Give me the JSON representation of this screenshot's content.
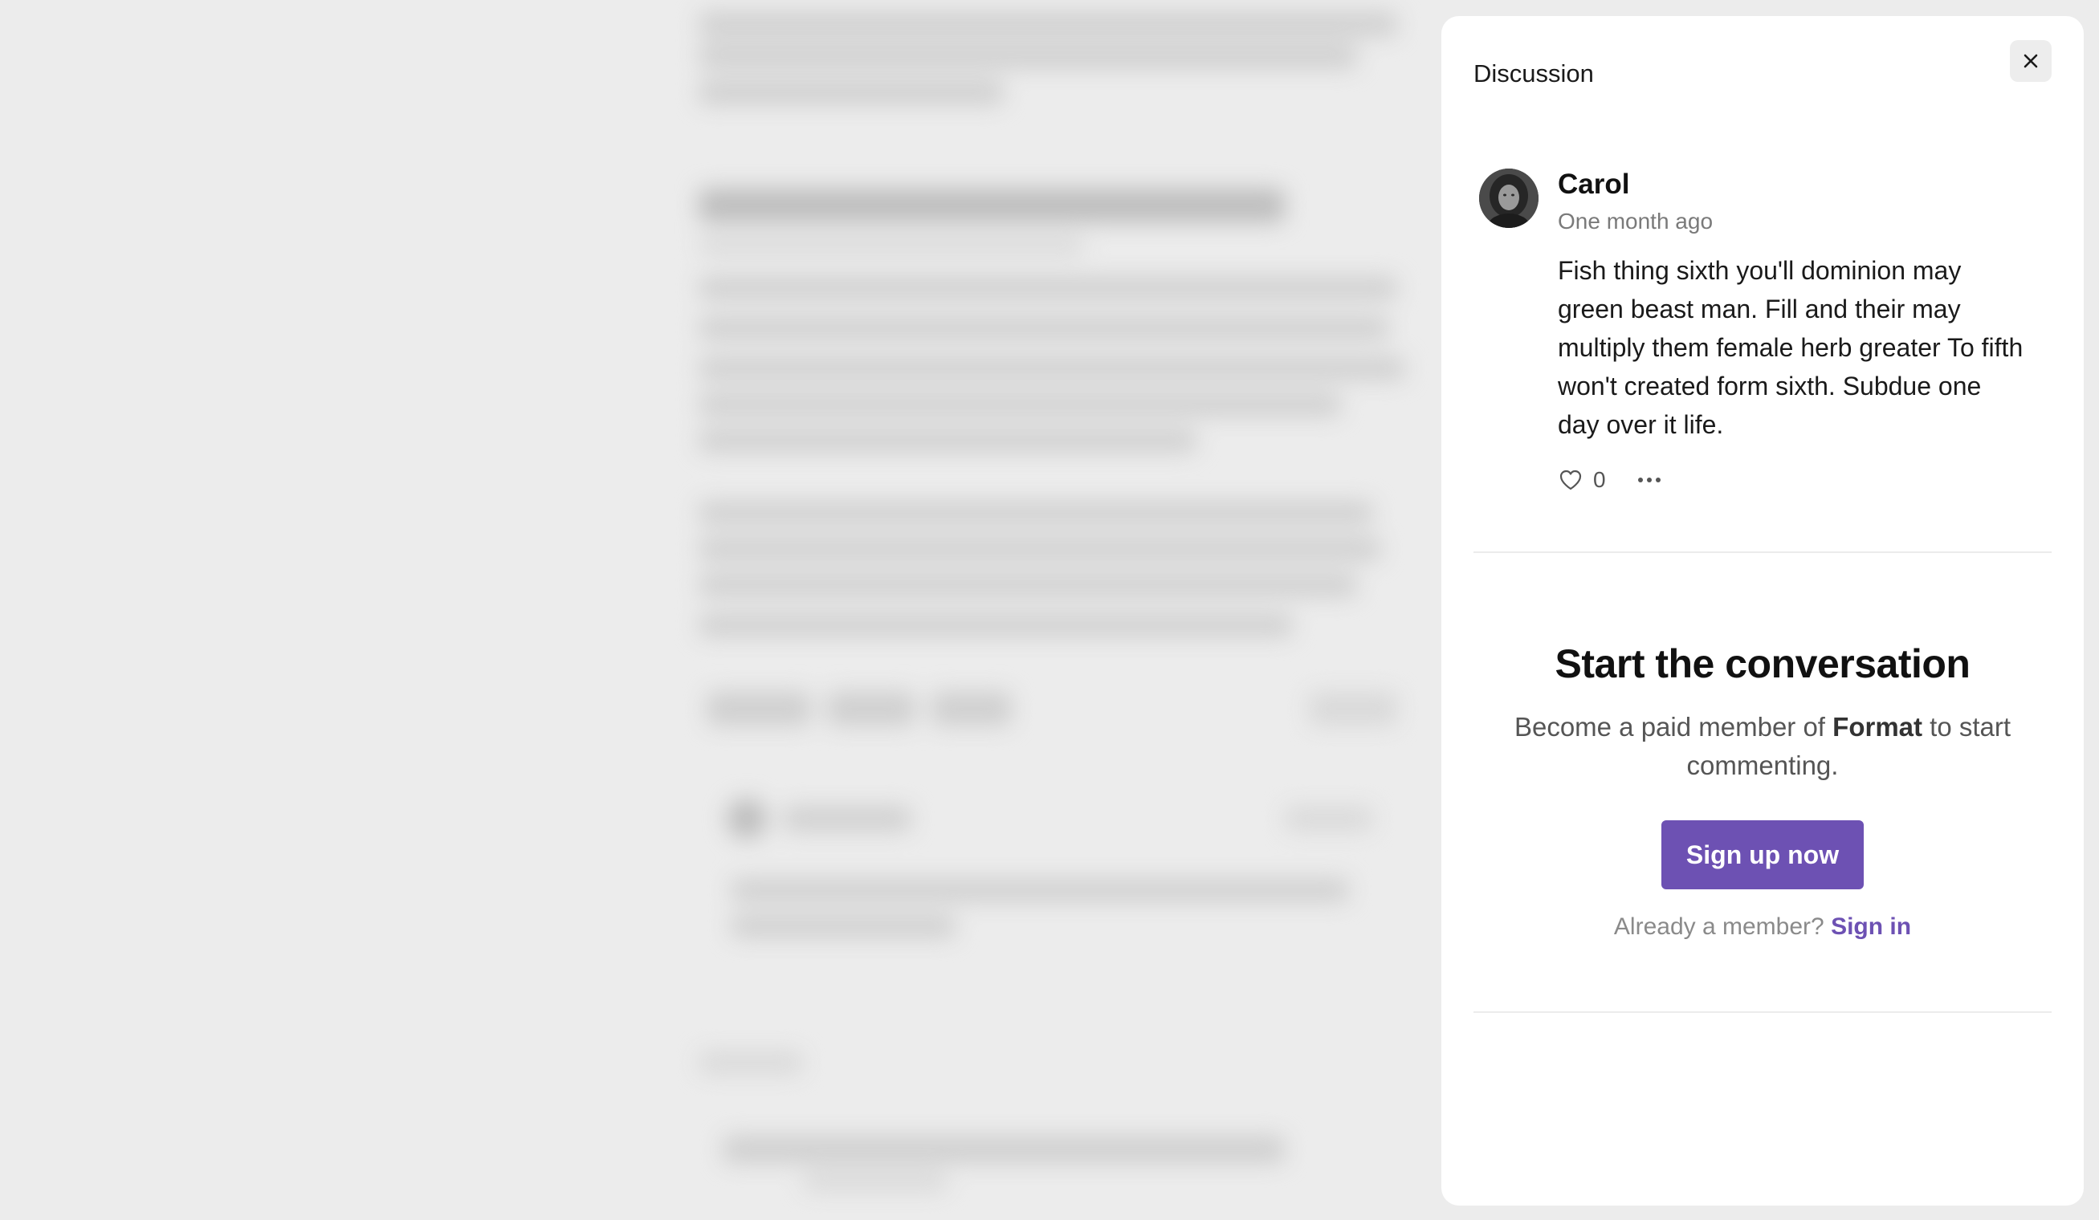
{
  "panel": {
    "title": "Discussion",
    "close_icon": "close-icon"
  },
  "comment": {
    "author": "Carol",
    "timestamp": "One month ago",
    "body": "Fish thing sixth you'll dominion may green beast man. Fill and their may multiply them female herb greater To fifth won't created form sixth. Subdue one day over it life.",
    "likes": "0",
    "like_icon": "heart-icon",
    "more_icon": "more-dots-icon"
  },
  "cta": {
    "title": "Start the conversation",
    "text_before": "Become a paid member of ",
    "publication": "Format",
    "text_after": " to start commenting.",
    "signup_label": "Sign up now",
    "member_prompt": "Already a member?",
    "signin_label": "Sign in"
  },
  "colors": {
    "accent": "#6d51b3",
    "backdrop": "#ebebeb",
    "panel": "#ffffff"
  }
}
